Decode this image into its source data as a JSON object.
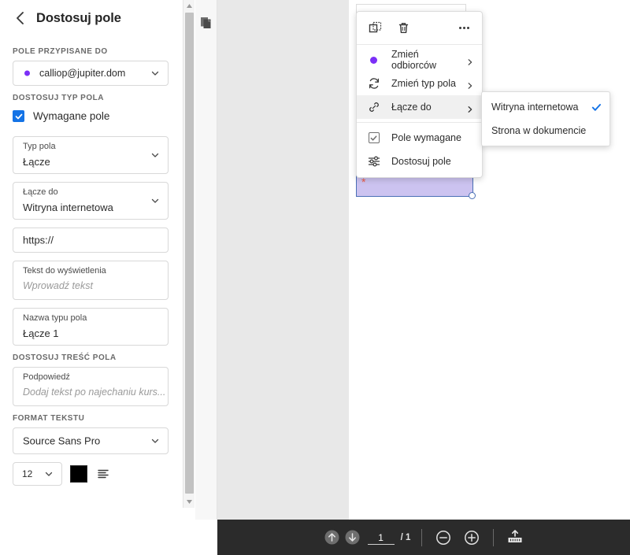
{
  "sidebar": {
    "back_icon": "back-chevron-icon",
    "title": "Dostosuj pole",
    "sections": {
      "assigned_to_label": "POLE PRZYPISANE DO",
      "field_type_label": "DOSTOSUJ TYP POLA",
      "field_content_label": "DOSTOSUJ TREŚĆ POLA",
      "text_format_label": "FORMAT TEKSTU"
    },
    "recipient": {
      "value": "calliop@jupiter.dom",
      "dot_color": "#7b2ff7",
      "chevron_icon": "chevron-down-icon"
    },
    "required_checkbox": {
      "label": "Wymagane pole",
      "checked": true,
      "color": "#1473e6"
    },
    "fields": [
      {
        "label": "Typ pola",
        "value": "Łącze",
        "has_chevron": true
      },
      {
        "label": "Łącze do",
        "value": "Witryna internetowa",
        "has_chevron": true
      },
      {
        "label": "",
        "value": "https://",
        "has_chevron": false
      },
      {
        "label": "Tekst do wyświetlenia",
        "value": "Wprowadź tekst",
        "is_placeholder": true,
        "has_chevron": false
      },
      {
        "label": "Nazwa typu pola",
        "value": "Łącze 1",
        "has_chevron": false
      }
    ],
    "hint_field": {
      "label": "Podpowiedź",
      "value": "Dodaj tekst po najechaniu kurs...",
      "is_placeholder": true
    },
    "font_family": {
      "value": "Source Sans Pro",
      "chevron_icon": "chevron-down-icon"
    },
    "font_size": {
      "value": "12",
      "chevron_icon": "chevron-down-icon"
    },
    "text_color": {
      "swatch": "#000000"
    },
    "align_icon": "text-align-icon"
  },
  "context_menu": {
    "toolbar": {
      "duplicate_icon": "duplicate-field-icon",
      "delete_icon": "trash-icon",
      "more_icon": "more-options-icon"
    },
    "items": [
      {
        "label": "Zmień odbiorców",
        "icon": "recipient-dot-icon",
        "has_submenu": true
      },
      {
        "label": "Zmień typ pola",
        "icon": "change-field-type-icon",
        "has_submenu": true
      },
      {
        "label": "Łącze do",
        "icon": "link-icon",
        "has_submenu": true,
        "highlighted": true
      },
      {
        "label": "Pole wymagane",
        "icon": "checkbox-checked-icon",
        "has_submenu": false
      },
      {
        "label": "Dostosuj pole",
        "icon": "settings-sliders-icon",
        "has_submenu": false
      }
    ]
  },
  "submenu": {
    "items": [
      {
        "label": "Witryna internetowa",
        "checked": true
      },
      {
        "label": "Strona w dokumencie",
        "checked": false
      }
    ],
    "check_color": "#1473e6"
  },
  "document": {
    "form_field": {
      "required_marker": "*",
      "fill_color": "#ccc3f0",
      "border_color": "#4a6fb5"
    },
    "thumbnail_icon": "page-thumbnails-icon"
  },
  "bottom_bar": {
    "prev_page_icon": "arrow-up-circle-icon",
    "next_page_icon": "arrow-down-circle-icon",
    "current_page": "1",
    "page_total": "/ 1",
    "zoom_out_icon": "zoom-out-icon",
    "zoom_in_icon": "zoom-in-icon",
    "fit_width_icon": "fit-to-width-icon"
  }
}
